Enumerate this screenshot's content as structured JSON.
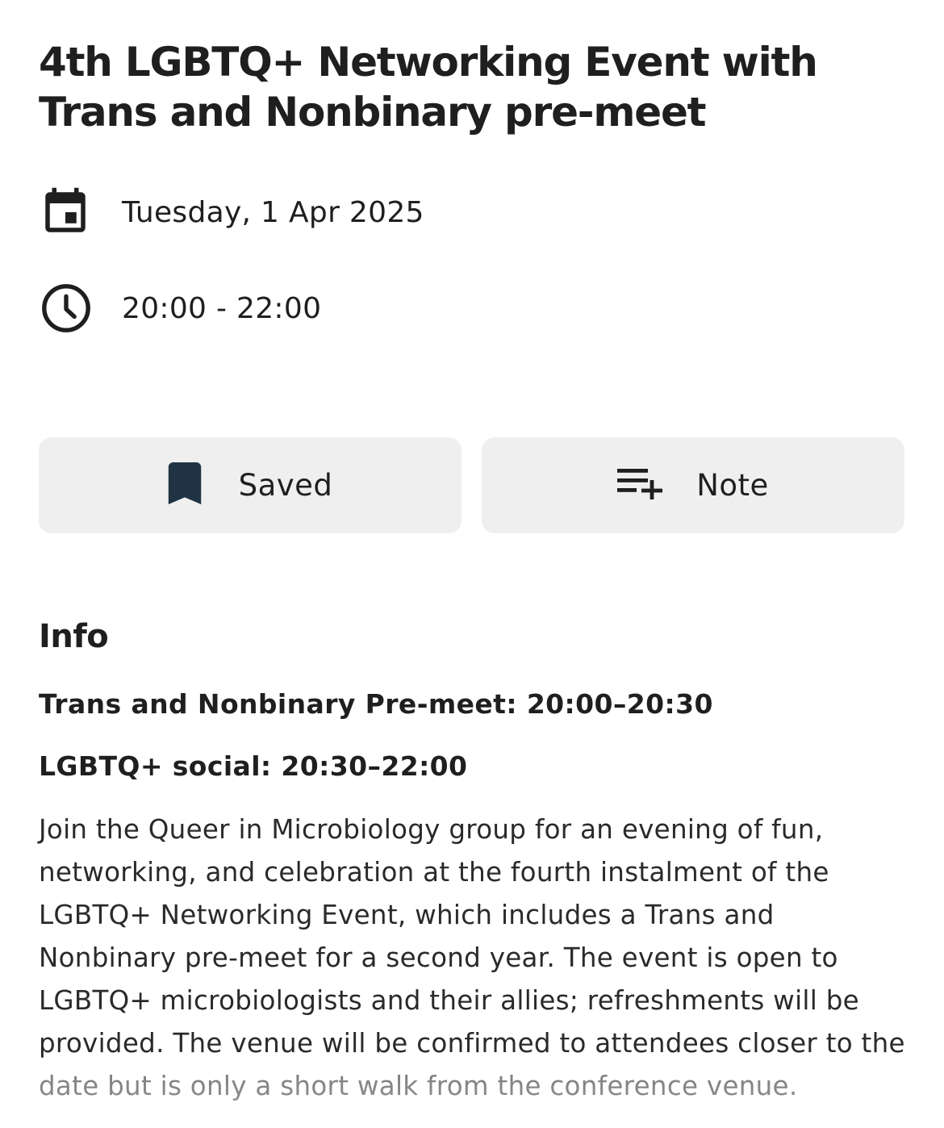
{
  "event": {
    "title": "4th LGBTQ+ Networking Event with Trans and Nonbinary pre-meet",
    "date": "Tuesday, 1 Apr 2025",
    "time": "20:00 - 22:00"
  },
  "actions": {
    "saved_label": "Saved",
    "note_label": "Note"
  },
  "info": {
    "heading": "Info",
    "pre_meet": "Trans and Nonbinary Pre-meet: 20:00–20:30",
    "social": "LGBTQ+ social: 20:30–22:00",
    "description": "Join the Queer in Microbiology group for an evening of fun, networking, and celebration at the fourth instalment of the LGBTQ+ Networking Event, which includes a Trans and Nonbinary pre-meet for a second year. The event is open to LGBTQ+ microbiologists and their allies; refreshments will be provided. The venue will be confirmed to attendees closer to the date but is only a short walk from the conference venue."
  },
  "icons": {
    "date": "calendar-icon",
    "time": "clock-icon",
    "saved": "bookmark-filled-icon",
    "note": "playlist-add-icon"
  },
  "colors": {
    "button_bg": "#efefef",
    "bookmark": "#1f3344",
    "text": "#1f1f1f"
  }
}
